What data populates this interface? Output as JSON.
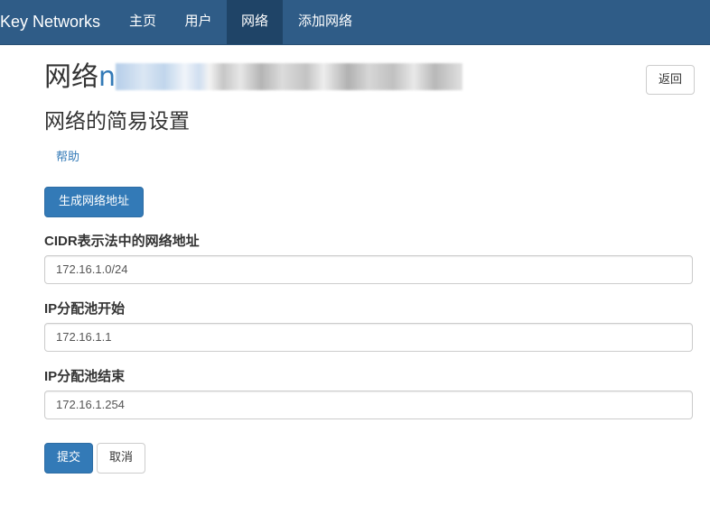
{
  "navbar": {
    "brand": "Key Networks",
    "items": [
      {
        "label": "主页",
        "active": false
      },
      {
        "label": "用户",
        "active": false
      },
      {
        "label": "网络",
        "active": true
      },
      {
        "label": "添加网络",
        "active": false
      }
    ],
    "background": "#2f5c87",
    "active_background": "#1f4467"
  },
  "header": {
    "title_prefix": "网络",
    "title_visible_start": "n",
    "back_label": "返回"
  },
  "section": {
    "subtitle": "网络的简易设置",
    "help_label": "帮助",
    "generate_label": "生成网络地址"
  },
  "form": {
    "cidr": {
      "label": "CIDR表示法中的网络地址",
      "value": "172.16.1.0/24"
    },
    "pool_start": {
      "label": "IP分配池开始",
      "value": "172.16.1.1"
    },
    "pool_end": {
      "label": "IP分配池结束",
      "value": "172.16.1.254"
    },
    "submit_label": "提交",
    "cancel_label": "取消"
  },
  "colors": {
    "primary": "#337ab7",
    "link": "#337ab7"
  }
}
